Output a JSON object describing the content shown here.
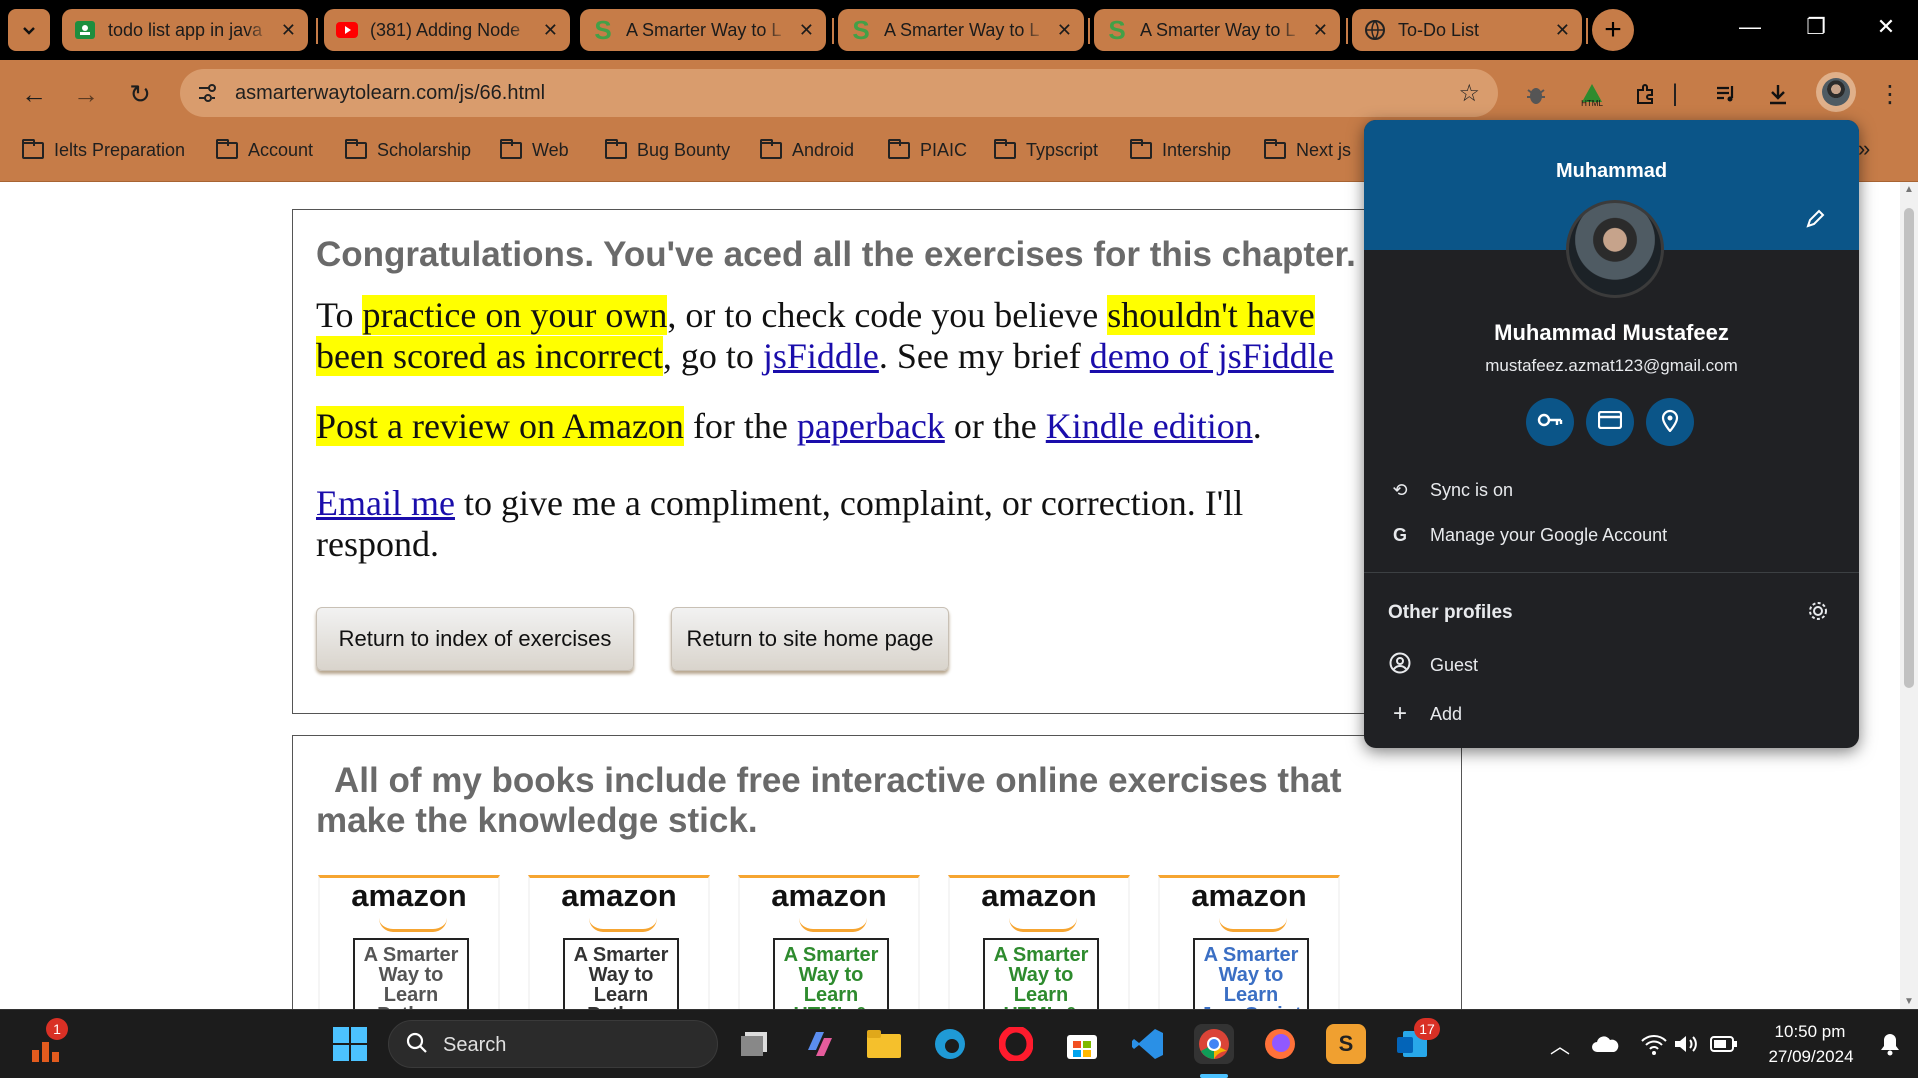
{
  "tabs": [
    {
      "title": "todo list app in java",
      "icon": "google-classroom-icon",
      "color": "#1e8e3e"
    },
    {
      "title": "(381) Adding Node",
      "icon": "youtube-icon",
      "color": "#ff0000"
    },
    {
      "title": "A Smarter Way to L",
      "icon": "smarter-way-icon",
      "color": "#43a047"
    },
    {
      "title": "A Smarter Way to L",
      "icon": "smarter-way-icon",
      "color": "#43a047"
    },
    {
      "title": "A Smarter Way to L",
      "icon": "smarter-way-icon",
      "color": "#43a047"
    },
    {
      "title": "To-Do List",
      "icon": "globe-icon",
      "color": "#666666"
    }
  ],
  "address": {
    "url": "asmarterwaytolearn.com/js/66.html"
  },
  "bookmarks": [
    "Ielts Preparation",
    "Account",
    "Scholarship",
    "Web",
    "Bug Bounty",
    "Android",
    "PIAIC",
    "Typscript",
    "Intership",
    "Next js"
  ],
  "page": {
    "heading": "Congratulations. You've aced all the exercises for this chapter.",
    "p1": {
      "a": "To ",
      "hl1": "practice on your own",
      "b": ", or to check code you believe ",
      "hl2a": "shouldn't have",
      "hl2b": "been scored as incorrect",
      "c": ", go to ",
      "link1": "jsFiddle",
      "d": ". See my brief ",
      "link2": "demo of jsFiddle"
    },
    "p2": {
      "hl": "Post a review on Amazon",
      "a": " for the ",
      "link1": "paperback",
      "b": " or the ",
      "link2": "Kindle edition",
      "c": "."
    },
    "p3": {
      "link": "Email me",
      "a": " to give me a compliment, complaint, or correction. I'll",
      "b": "respond."
    },
    "buttons": [
      "Return to index of exercises",
      "Return to site home page"
    ],
    "books_heading": "All of my books include free interactive online exercises that make the knowledge stick.",
    "books": [
      {
        "brand": "amazon",
        "cover": "A Smarter Way to Learn Python",
        "color": "#555555"
      },
      {
        "brand": "amazon",
        "cover": "A Smarter Way to Learn Python",
        "color": "#333333"
      },
      {
        "brand": "amazon",
        "cover": "A Smarter Way to Learn HTML & CSS",
        "color": "#2e8b2e"
      },
      {
        "brand": "amazon",
        "cover": "A Smarter Way to Learn HTML & CSS",
        "color": "#2e8b2e"
      },
      {
        "brand": "amazon",
        "cover": "A Smarter Way to Learn JavaScript",
        "color": "#3b6fc4"
      }
    ]
  },
  "profile": {
    "header_name": "Muhammad",
    "full_name": "Muhammad Mustafeez",
    "email": "mustafeez.azmat123@gmail.com",
    "sync": "Sync is on",
    "manage": "Manage your Google Account",
    "other_profiles": "Other profiles",
    "guest": "Guest",
    "add": "Add"
  },
  "taskbar": {
    "search_placeholder": "Search",
    "time": "10:50 pm",
    "date": "27/09/2024",
    "badge_left": "1",
    "badge_right": "17"
  },
  "colors": {
    "accent": "#c67c48",
    "panel_header": "#0b5588",
    "highlight": "#ffff00",
    "link": "#1a0dab"
  }
}
